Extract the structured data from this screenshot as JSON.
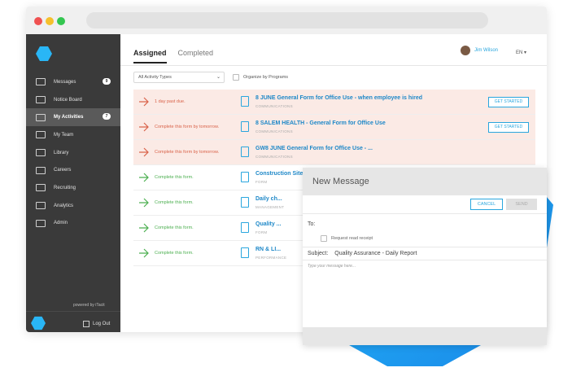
{
  "browser": {},
  "sidebar": {
    "items": [
      {
        "label": "Messages",
        "badge": "9"
      },
      {
        "label": "Notice Board"
      },
      {
        "label": "My Activities",
        "badge": "7"
      },
      {
        "label": "My Team"
      },
      {
        "label": "Library"
      },
      {
        "label": "Careers"
      },
      {
        "label": "Recruiting"
      },
      {
        "label": "Analytics"
      },
      {
        "label": "Admin"
      }
    ],
    "powered_by": "powered by iTacit",
    "logout_label": "Log Out"
  },
  "header": {
    "tabs": [
      {
        "label": "Assigned"
      },
      {
        "label": "Completed"
      }
    ],
    "user_name": "Jim Wilson",
    "language": "EN ▾"
  },
  "filters": {
    "activity_type": "All Activity Types",
    "organize_label": "Organize by Programs"
  },
  "rows": [
    {
      "status": "1 day past due.",
      "title": "8 JUNE General Form for Office Use - when employee is hired",
      "category": "COMMUNICATIONS",
      "action": "GET STARTED"
    },
    {
      "status": "Complete this form by tomorrow.",
      "title": "8 SALEM HEALTH - General Form for Office Use",
      "category": "COMMUNICATIONS",
      "action": "GET STARTED"
    },
    {
      "status": "Complete this form by tomorrow.",
      "title": "GW8 JUNE General Form for Office Use - ...",
      "category": "COMMUNICATIONS"
    },
    {
      "status": "Complete this form.",
      "title": "Construction Site ...",
      "category": "FORM"
    },
    {
      "status": "Complete this form.",
      "title": "Daily ch...",
      "category": "MANAGEMENT"
    },
    {
      "status": "Complete this form.",
      "title": "Quality ...",
      "category": "FORM"
    },
    {
      "status": "Complete this form.",
      "title": "RN & LI...",
      "category": "PERFORMANCE"
    }
  ],
  "modal": {
    "title": "New Message",
    "cancel_label": "CANCEL",
    "send_label": "SEND",
    "to_label": "To:",
    "read_receipt_label": "Request read receipt",
    "subject_label": "Subject:",
    "subject_value": "Quality Assurance - Daily Report",
    "message_placeholder": "Type your message here..."
  },
  "colors": {
    "accent": "#29a6de",
    "sidebar_bg": "#3a3a3a",
    "overdue": "#d9634a",
    "ok": "#4caf50"
  }
}
